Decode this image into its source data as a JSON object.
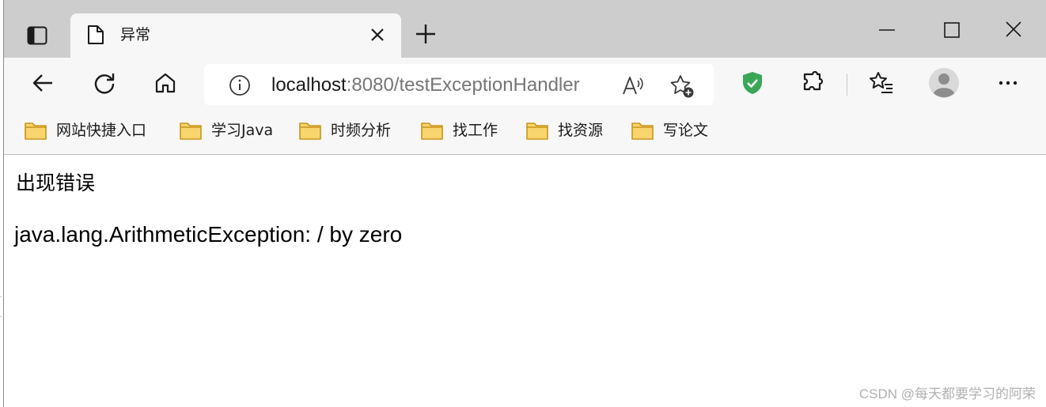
{
  "browser": {
    "tab": {
      "title": "异常",
      "favicon": "page-icon"
    },
    "window_controls": [
      "minimize-icon",
      "maximize-icon",
      "close-icon"
    ],
    "toolbar": {
      "address": {
        "host": "localhost",
        "port_path": ":8080/testExceptionHandler"
      },
      "icons": [
        "back-icon",
        "refresh-icon",
        "home-icon",
        "info-icon",
        "read-aloud-icon",
        "add-favorite-icon",
        "shield-check-icon",
        "extensions-icon",
        "favorites-icon",
        "profile-icon",
        "more-icon"
      ]
    },
    "favorites": [
      {
        "label": "网站快捷入口"
      },
      {
        "label": "学习Java"
      },
      {
        "label": "时频分析"
      },
      {
        "label": "找工作"
      },
      {
        "label": "找资源"
      },
      {
        "label": "写论文"
      }
    ],
    "colors": {
      "shield": "#3aa757",
      "folder": "#f9d56e",
      "folder_edge": "#c9951b"
    }
  },
  "page": {
    "heading": "出现错误",
    "message": "java.lang.ArithmeticException: / by zero"
  },
  "watermark": "CSDN @每天都要学习的阿荣"
}
